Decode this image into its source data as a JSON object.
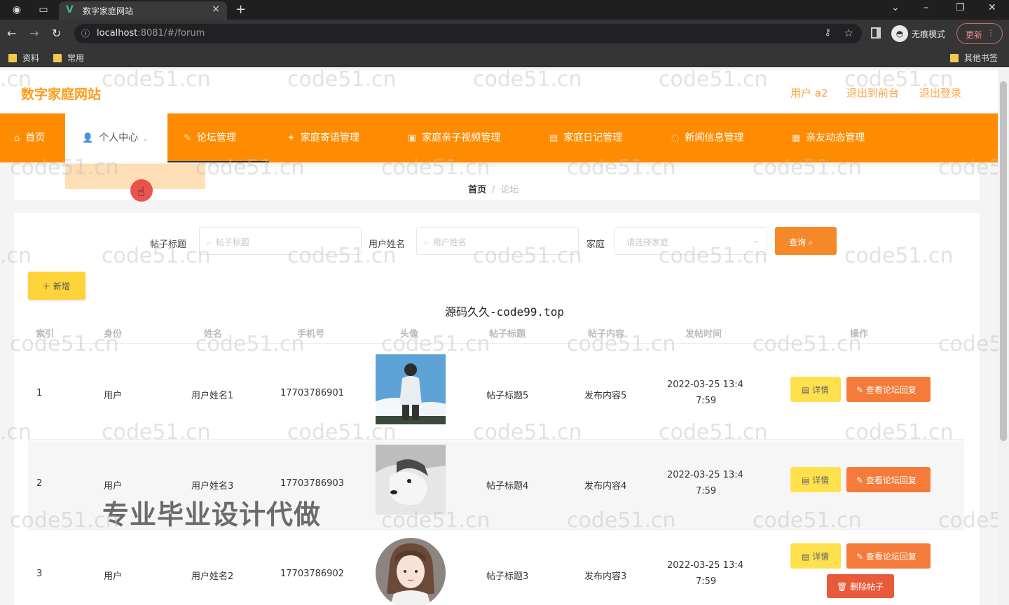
{
  "browser": {
    "tab_title": "数字家庭网站",
    "url_host": "localhost",
    "url_rest": ":8081/#/forum",
    "incognito_label": "无痕模式",
    "update_label": "更新",
    "bookmarks": [
      "资料",
      "常用"
    ],
    "other_bookmarks": "其他书签"
  },
  "header": {
    "logo": "数字家庭网站",
    "user": "用户 a2",
    "back_to_front": "退出到前台",
    "logout": "退出登录"
  },
  "menu": {
    "items": [
      {
        "label": "首页",
        "icon": "home-icon"
      },
      {
        "label": "个人中心",
        "icon": "user-icon"
      },
      {
        "label": "论坛管理",
        "icon": "forum-icon"
      },
      {
        "label": "家庭寄语管理",
        "icon": "message-icon"
      },
      {
        "label": "家庭亲子视频管理",
        "icon": "video-icon"
      },
      {
        "label": "家庭日记管理",
        "icon": "diary-icon"
      },
      {
        "label": "新闻信息管理",
        "icon": "news-icon"
      },
      {
        "label": "亲友动态管理",
        "icon": "dynamic-icon"
      }
    ],
    "active_index": 1,
    "accent": "#ff8c00"
  },
  "breadcrumb": {
    "home": "首页",
    "separator": "/",
    "current": "论坛"
  },
  "search": {
    "title_label": "帖子标题",
    "title_placeholder": "帖子标题",
    "user_label": "用户姓名",
    "user_placeholder": "用户姓名",
    "family_label": "家庭",
    "family_placeholder": "请选择家庭",
    "query_button": "查询"
  },
  "add_button": "新增",
  "watermark_source": "源码久久-code99.top",
  "watermark_site": "code51.cn",
  "ad_text": "专业毕业设计代做",
  "table": {
    "headers": [
      "索引",
      "身份",
      "姓名",
      "手机号",
      "头像",
      "帖子标题",
      "帖子内容",
      "发帖时间",
      "操作"
    ],
    "rows": [
      {
        "index": "1",
        "role": "用户",
        "name": "用户姓名1",
        "phone": "17703786901",
        "title": "帖子标题5",
        "content": "发布内容5",
        "time_a": "2022-03-25 13:4",
        "time_b": "7:59",
        "avatar": "boy-sky"
      },
      {
        "index": "2",
        "role": "用户",
        "name": "用户姓名3",
        "phone": "17703786903",
        "title": "帖子标题4",
        "content": "发布内容4",
        "time_a": "2022-03-25 13:4",
        "time_b": "7:59",
        "avatar": "husky"
      },
      {
        "index": "3",
        "role": "用户",
        "name": "用户姓名2",
        "phone": "17703786902",
        "title": "帖子标题3",
        "content": "发布内容3",
        "time_a": "2022-03-25 13:4",
        "time_b": "7:59",
        "avatar": "girl-illustration"
      }
    ],
    "actions": {
      "detail": "详情",
      "view_reply": "查看论坛回复",
      "delete": "删除帖子"
    }
  }
}
